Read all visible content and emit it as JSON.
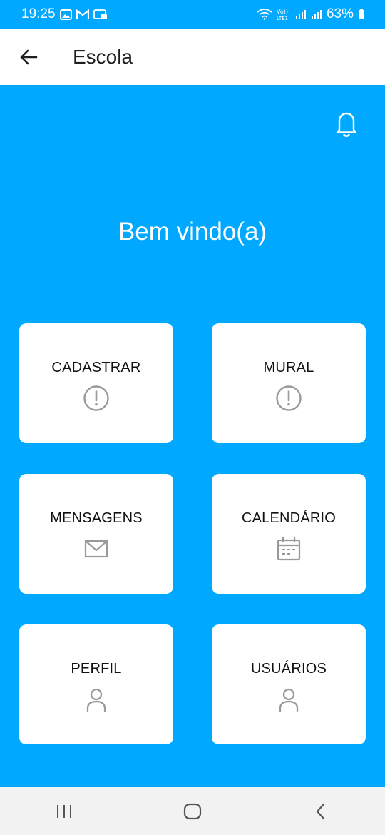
{
  "status_bar": {
    "time": "19:25",
    "battery": "63%",
    "icons": [
      "gallery-icon",
      "gmail-icon",
      "app-icon",
      "wifi-icon",
      "volte-icon",
      "signal-icon",
      "signal-icon",
      "battery-icon"
    ]
  },
  "header": {
    "title": "Escola",
    "back_icon": "arrow-left-icon"
  },
  "notifications": {
    "icon": "bell-icon"
  },
  "welcome": "Bem vindo(a)",
  "menu": [
    {
      "label": "CADASTRAR",
      "icon": "alert-circle-icon"
    },
    {
      "label": "MURAL",
      "icon": "alert-circle-icon"
    },
    {
      "label": "MENSAGENS",
      "icon": "mail-icon"
    },
    {
      "label": "CALENDÁRIO",
      "icon": "calendar-icon"
    },
    {
      "label": "PERFIL",
      "icon": "user-icon"
    },
    {
      "label": "USUÁRIOS",
      "icon": "user-icon"
    }
  ],
  "nav": {
    "items": [
      "recent-apps-icon",
      "home-icon",
      "back-icon"
    ]
  },
  "colors": {
    "primary": "#00a9ff",
    "card": "#ffffff",
    "icon": "#999999",
    "nav_bg": "#f2f2f2"
  }
}
